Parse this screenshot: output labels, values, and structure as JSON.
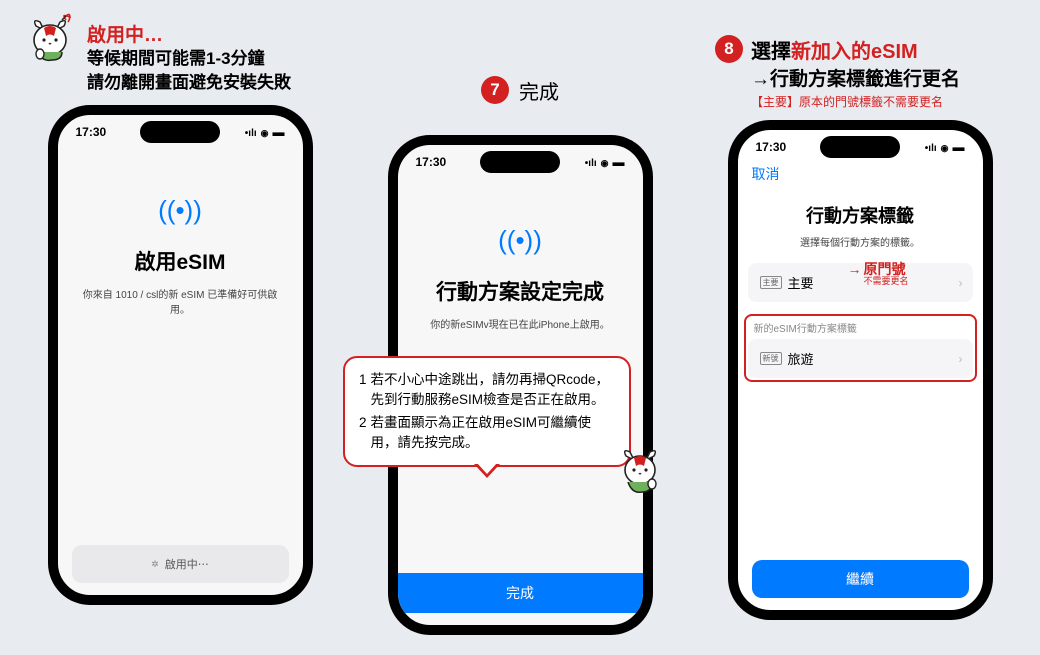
{
  "status_time": "17:30",
  "col1": {
    "title": "啟用中…",
    "sub1": "等候期間可能需1-3分鐘",
    "sub2": "請勿離開畫面避免安裝失敗",
    "screen_title": "啟用eSIM",
    "screen_desc": "你來自 1010 / csl的新 eSIM 已準備好可供啟用。",
    "loading": "啟用中⋯"
  },
  "col2": {
    "step": "7",
    "label": "完成",
    "screen_title": "行動方案設定完成",
    "screen_desc": "你的新eSIMv現在已在此iPhone上啟用。",
    "callout1": "若不小心中途跳出，請勿再掃QRcode，先到行動服務eSIM檢查是否正在啟用。",
    "callout2": "若畫面顯示為正在啟用eSIM可繼續使用，請先按完成。",
    "button": "完成"
  },
  "col3": {
    "step": "8",
    "line1a": "選擇",
    "line1b": "新加入的eSIM",
    "line2a": "→",
    "line2b": "行動方案標籤進行更名",
    "note": "【主要】原本的門號標籤不需要更名",
    "nav_cancel": "取消",
    "screen_title": "行動方案標籤",
    "screen_desc": "選擇每個行動方案的標籤。",
    "item1_tag": "主要",
    "item1_label": "主要",
    "annot1": "原門號",
    "annot1_sub": "不需要更名",
    "list2_header": "新的eSIM行動方案標籤",
    "item2_tag": "新號",
    "item2_label": "旅遊",
    "button": "繼續"
  }
}
